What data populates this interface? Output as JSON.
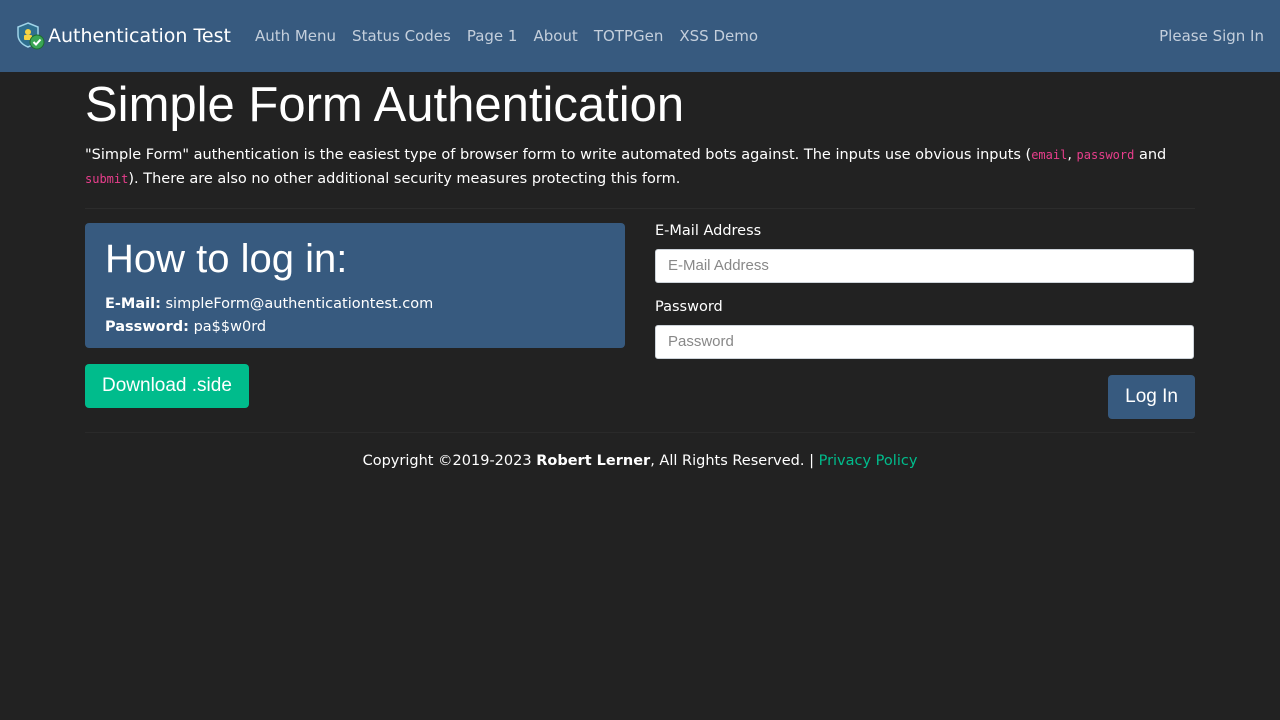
{
  "navbar": {
    "brand": "Authentication Test",
    "links": [
      "Auth Menu",
      "Status Codes",
      "Page 1",
      "About",
      "TOTPGen",
      "XSS Demo"
    ],
    "sign_in": "Please Sign In"
  },
  "main": {
    "title": "Simple Form Authentication",
    "intro_before": "\"Simple Form\" authentication is the easiest type of browser form to write automated bots against. The inputs use obvious inputs (",
    "code_email": "email",
    "code_password": "password",
    "code_submit": "submit",
    "sep1": ", ",
    "sep2": " and ",
    "intro_after": "). There are also no other additional security measures protecting this form."
  },
  "howto": {
    "title": "How to log in:",
    "email_label": "E-Mail:",
    "email_value": " simpleForm@authenticationtest.com",
    "password_label": "Password:",
    "password_value": " pa$$w0rd"
  },
  "download_label": "Download .side",
  "form": {
    "email_label": "E-Mail Address",
    "email_placeholder": "E-Mail Address",
    "email_value": "",
    "password_label": "Password",
    "password_placeholder": "Password",
    "password_value": "",
    "submit_label": "Log In"
  },
  "footer": {
    "copyright": "Copyright ©2019-2023 ",
    "author": "Robert Lerner",
    "rights": ", All Rights Reserved. | ",
    "privacy": "Privacy Policy"
  },
  "colors": {
    "navbar_bg": "#375a7f",
    "page_bg": "#222222",
    "accent_green": "#00bc8c",
    "code_pink": "#e83e8c"
  }
}
